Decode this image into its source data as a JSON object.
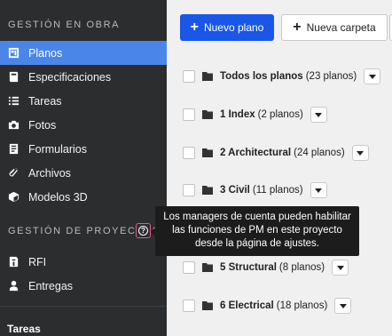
{
  "sidebar": {
    "section1_title": "GESTIÓN EN OBRA",
    "items": [
      {
        "label": "Planos",
        "icon": "blueprint-icon"
      },
      {
        "label": "Especificaciones",
        "icon": "book-icon"
      },
      {
        "label": "Tareas",
        "icon": "list-icon"
      },
      {
        "label": "Fotos",
        "icon": "camera-icon"
      },
      {
        "label": "Formularios",
        "icon": "form-icon"
      },
      {
        "label": "Archivos",
        "icon": "paperclip-icon"
      },
      {
        "label": "Modelos 3D",
        "icon": "cube-icon"
      }
    ],
    "section2_title": "GESTIÓN DE PROYECTOS",
    "project_items": [
      {
        "label": "RFI",
        "icon": "rfi-icon"
      },
      {
        "label": "Entregas",
        "icon": "person-icon"
      }
    ],
    "bottom_title": "Tareas",
    "active_color": "#4a86e8"
  },
  "toolbar": {
    "new_plan": "Nuevo plano",
    "new_folder": "Nueva carpeta",
    "primary_color": "#1a56e8"
  },
  "folders": [
    {
      "name": "Todos los planos",
      "count": "(23 planos)"
    },
    {
      "name": "1 Index",
      "count": "(2 planos)"
    },
    {
      "name": "2 Architectural",
      "count": "(24 planos)"
    },
    {
      "name": "3 Civil",
      "count": "(11 planos)"
    },
    {
      "name": "5 Structural",
      "count": "(8 planos)"
    },
    {
      "name": "6 Electrical",
      "count": "(18 planos)"
    }
  ],
  "tooltip": {
    "line1": "Los managers de cuenta pueden habilitar",
    "line2": "las funciones de PM en este proyecto",
    "line3": "desde la página de ajustes."
  }
}
